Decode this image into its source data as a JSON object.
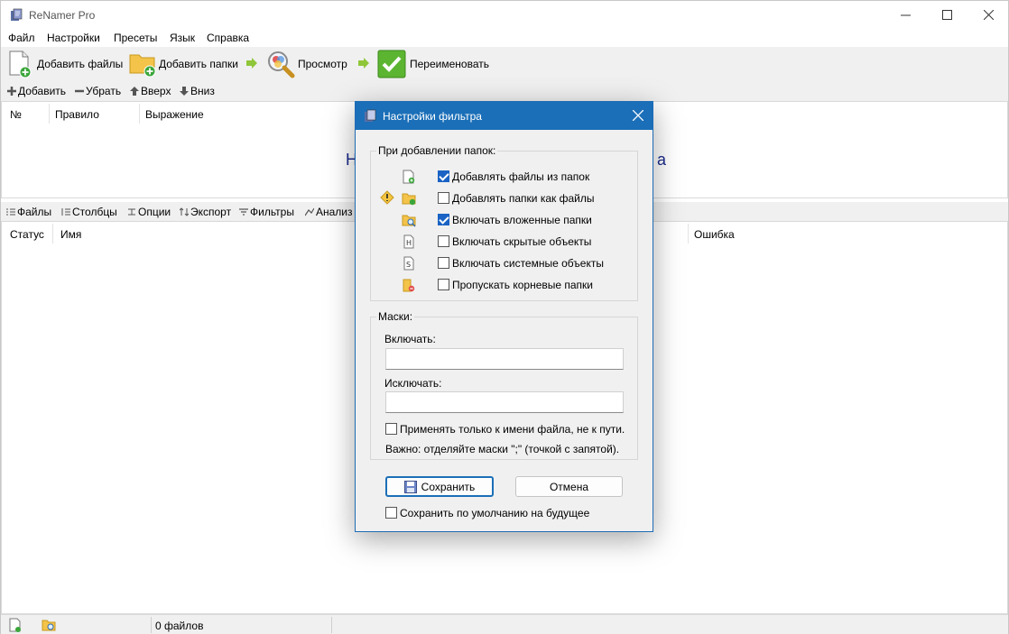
{
  "app": {
    "title": "ReNamer Pro"
  },
  "menu": [
    "Файл",
    "Настройки",
    "Пресеты",
    "Язык",
    "Справка"
  ],
  "toolbar": {
    "add_files": "Добавить файлы",
    "add_folders": "Добавить папки",
    "preview": "Просмотр",
    "rename": "Переименовать"
  },
  "rules_toolbar": {
    "add": "Добавить",
    "remove": "Убрать",
    "up": "Вверх",
    "down": "Вниз"
  },
  "rules_grid": {
    "columns": [
      "№",
      "Правило",
      "Выражение"
    ],
    "hint_left": "Н",
    "hint_right": "а"
  },
  "files_toolbar": [
    "Файлы",
    "Столбцы",
    "Опции",
    "Экспорт",
    "Фильтры",
    "Анализ"
  ],
  "files_grid": {
    "columns": [
      "Статус",
      "Имя",
      "Ошибка"
    ]
  },
  "statusbar": {
    "count": "0 файлов"
  },
  "dialog": {
    "title": "Настройки фильтра",
    "folders_group": "При добавлении папок:",
    "options": [
      {
        "label": "Добавлять файлы из папок",
        "checked": true,
        "icon": "file-add-icon"
      },
      {
        "label": "Добавлять папки как файлы",
        "checked": false,
        "icon": "folder-add-icon"
      },
      {
        "label": "Включать вложенные папки",
        "checked": true,
        "icon": "folder-search-icon"
      },
      {
        "label": "Включать скрытые объекты",
        "checked": false,
        "icon": "hidden-file-icon"
      },
      {
        "label": "Включать системные объекты",
        "checked": false,
        "icon": "system-file-icon"
      },
      {
        "label": "Пропускать корневые папки",
        "checked": false,
        "icon": "folder-skip-icon"
      }
    ],
    "masks_group": "Маски:",
    "include_label": "Включать:",
    "include_value": "",
    "exclude_label": "Исключать:",
    "exclude_value": "",
    "filename_only": "Применять только к имени файла, не к пути.",
    "filename_only_checked": false,
    "note": "Важно: отделяйте маски \";\" (точкой с запятой).",
    "save": "Сохранить",
    "cancel": "Отмена",
    "save_default": "Сохранить по умолчанию на будущее",
    "save_default_checked": false
  },
  "colors": {
    "accent": "#1b6fb8",
    "check": "#1a63c4",
    "hint": "#1a2a8a"
  }
}
